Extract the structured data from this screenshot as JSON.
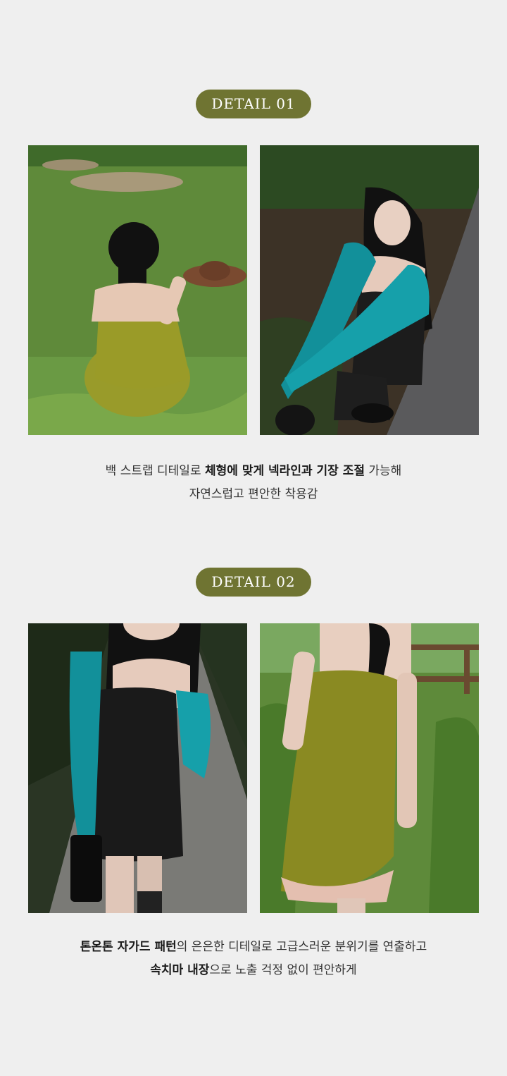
{
  "detail1": {
    "badge": "DETAIL 01",
    "caption_line1": {
      "pre": "백 스트랩 디테일로 ",
      "bold": "체형에 맞게 넥라인과 기장 조절",
      "post": " 가능해"
    },
    "caption_line2": "자연스럽고 편안한 착용감"
  },
  "detail2": {
    "badge": "DETAIL 02",
    "caption_line1": {
      "bold": "톤온톤 자가드 패턴",
      "post": "의 은은한 디테일로 고급스러운 분위기를 연출하고"
    },
    "caption_line2": {
      "bold": "속치마 내장",
      "post": "으로 노출 걱정 없이 편안하게"
    }
  },
  "colors": {
    "background": "#efefef",
    "badge": "#6f7432",
    "olive_dress": "#8a8a22",
    "teal_cardigan": "#12909a",
    "black_dress": "#1c1c1c"
  }
}
